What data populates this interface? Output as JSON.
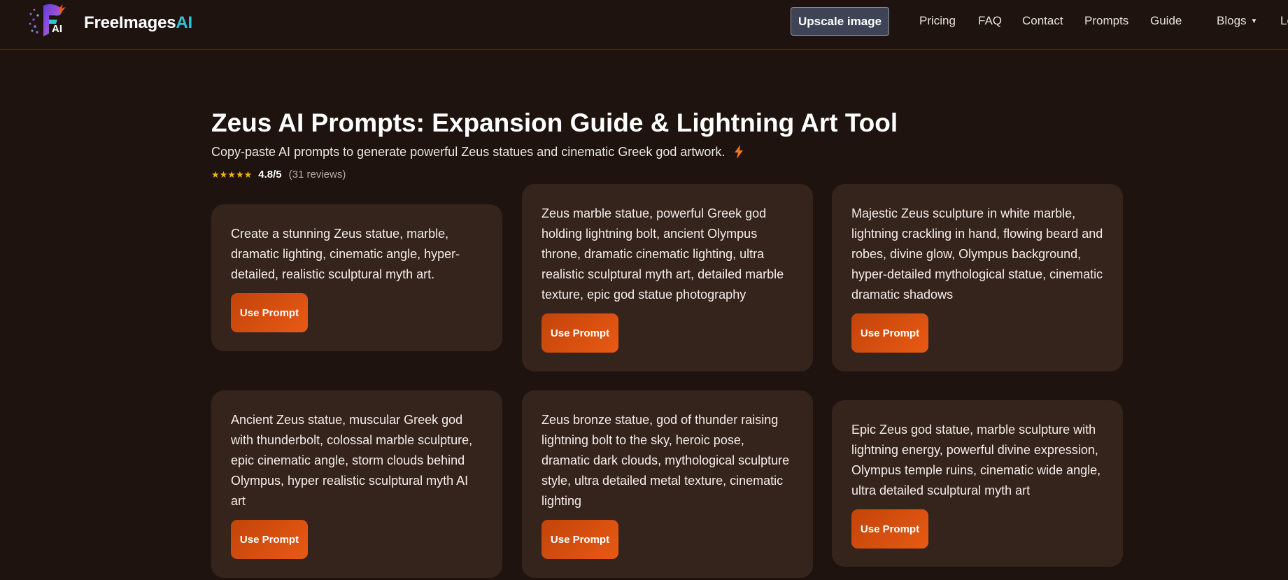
{
  "header": {
    "brand_main": "FreeImages",
    "brand_accent": "AI",
    "upscale_label": "Upscale image",
    "nav": [
      "Pricing",
      "FAQ",
      "Contact",
      "Prompts",
      "Guide",
      "Blogs",
      "Lo"
    ]
  },
  "hero": {
    "title": "Zeus AI Prompts: Expansion Guide & Lightning Art Tool",
    "subtitle": "Copy-paste AI prompts to generate powerful Zeus statues and cinematic Greek god artwork.",
    "stars": "★★★★★",
    "score": "4.8/5",
    "reviews": "(31 reviews)"
  },
  "cards": [
    {
      "text": "Create a stunning Zeus statue, marble, dramatic lighting, cinematic angle, hyper-detailed, realistic sculptural myth art.",
      "button": "Use Prompt"
    },
    {
      "text": "Zeus marble statue, powerful Greek god holding lightning bolt, ancient Olympus throne, dramatic cinematic lighting, ultra realistic sculptural myth art, detailed marble texture, epic god statue photography",
      "button": "Use Prompt"
    },
    {
      "text": "Majestic Zeus sculpture in white marble, lightning crackling in hand, flowing beard and robes, divine glow, Olympus background, hyper-detailed mythological statue, cinematic dramatic shadows",
      "button": "Use Prompt"
    },
    {
      "text": "Ancient Zeus statue, muscular Greek god with thunderbolt, colossal marble sculpture, epic cinematic angle, storm clouds behind Olympus, hyper realistic sculptural myth AI art",
      "button": "Use Prompt"
    },
    {
      "text": "Zeus bronze statue, god of thunder raising lightning bolt to the sky, heroic pose, dramatic dark clouds, mythological sculpture style, ultra detailed metal texture, cinematic lighting",
      "button": "Use Prompt"
    },
    {
      "text": "Epic Zeus god statue, marble sculpture with lightning energy, powerful divine expression, Olympus temple ruins, cinematic wide angle, ultra detailed sculptural myth art",
      "button": "Use Prompt"
    }
  ],
  "colors": {
    "background": "#1e130e",
    "card": "#35241c",
    "accent": "#e0550f",
    "brand_accent": "#2ec4d6",
    "star": "#f5b400"
  },
  "icons": [
    "logo-icon",
    "bolt-icon",
    "chevron-down-icon"
  ]
}
